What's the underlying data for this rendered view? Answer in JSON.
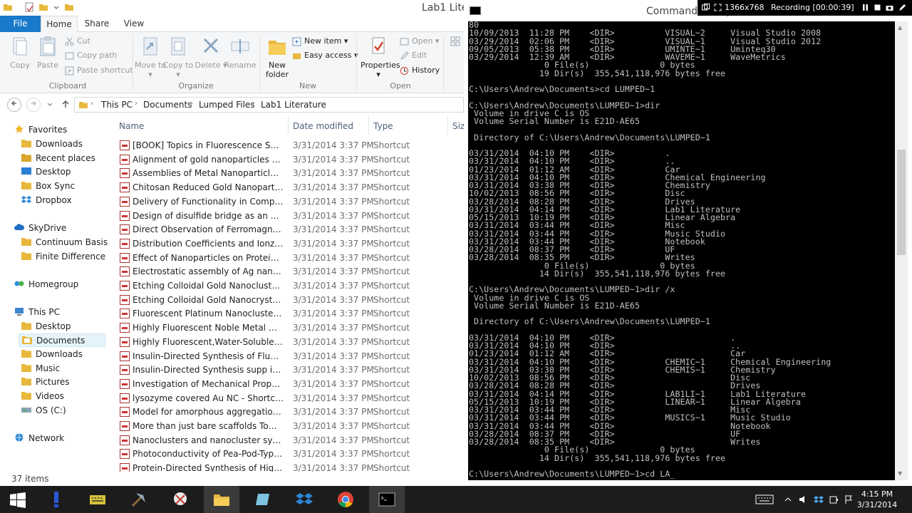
{
  "explorer": {
    "title": "Lab1 Lite",
    "tabs": {
      "file": "File",
      "home": "Home",
      "share": "Share",
      "view": "View"
    },
    "ribbon": {
      "copy": "Copy",
      "paste": "Paste",
      "cut": "Cut",
      "copy_path": "Copy path",
      "paste_shortcut": "Paste shortcut",
      "move_to": "Move to ▾",
      "copy_to": "Copy to ▾",
      "delete": "Delete ▾",
      "rename": "Rename",
      "new_folder": "New folder",
      "new_item": "New item ▾",
      "easy_access": "Easy access ▾",
      "properties": "Properties ▾",
      "open": "Open ▾",
      "edit": "Edit",
      "history": "History",
      "groups": {
        "clipboard": "Clipboard",
        "organize": "Organize",
        "new": "New",
        "open": "Open"
      }
    },
    "breadcrumb": [
      "This PC",
      "Documents",
      "Lumped Files",
      "Lab1 Literature"
    ],
    "nav": {
      "favorites": "Favorites",
      "downloads": "Downloads",
      "recent_places": "Recent places",
      "desktop": "Desktop",
      "box_sync": "Box Sync",
      "dropbox": "Dropbox",
      "skydrive": "SkyDrive",
      "continuum_basis": "Continuum Basis",
      "finite_difference": "Finite Difference Ap",
      "homegroup": "Homegroup",
      "this_pc": "This PC",
      "pc_desktop": "Desktop",
      "pc_documents": "Documents",
      "pc_downloads": "Downloads",
      "pc_music": "Music",
      "pc_pictures": "Pictures",
      "pc_videos": "Videos",
      "pc_os": "OS (C:)",
      "network": "Network"
    },
    "columns": {
      "name": "Name",
      "date": "Date modified",
      "type": "Type",
      "size": "Siz"
    },
    "files": [
      {
        "name": "[BOOK] Topics in Fluorescence Spectrosc...",
        "date": "3/31/2014 3:37 PM",
        "type": "Shortcut"
      },
      {
        "name": "Alignment of gold nanoparticles using in...",
        "date": "3/31/2014 3:37 PM",
        "type": "Shortcut"
      },
      {
        "name": "Assemblies of Metal Nanoparticles and S...",
        "date": "3/31/2014 3:37 PM",
        "type": "Shortcut"
      },
      {
        "name": "Chitosan Reduced Gold Nanoparticles as ...",
        "date": "3/31/2014 3:37 PM",
        "type": "Shortcut"
      },
      {
        "name": "Delivery of Functionality in Complex Foo...",
        "date": "3/31/2014 3:37 PM",
        "type": "Shortcut"
      },
      {
        "name": "Design of disulfide bridge as an alternativ...",
        "date": "3/31/2014 3:37 PM",
        "type": "Shortcut"
      },
      {
        "name": "Direct Observation of Ferromagnetic Spi...",
        "date": "3/31/2014 3:37 PM",
        "type": "Shortcut"
      },
      {
        "name": "Distribution Coefficients and Ionzation C...",
        "date": "3/31/2014 3:37 PM",
        "type": "Shortcut"
      },
      {
        "name": "Effect of Nanoparticles on Protein Foldin...",
        "date": "3/31/2014 3:37 PM",
        "type": "Shortcut"
      },
      {
        "name": "Electrostatic assembly of Ag nanoparticle...",
        "date": "3/31/2014 3:37 PM",
        "type": "Shortcut"
      },
      {
        "name": "Etching Colloidal Gold Nanoclusters sup...",
        "date": "3/31/2014 3:37 PM",
        "type": "Shortcut"
      },
      {
        "name": "Etching Colloidal Gold Nanocrystals with...",
        "date": "3/31/2014 3:37 PM",
        "type": "Shortcut"
      },
      {
        "name": "Fluorescent Platinum Nanoclusters Synth...",
        "date": "3/31/2014 3:37 PM",
        "type": "Shortcut"
      },
      {
        "name": "Highly Fluorescent Noble Metal Quantu...",
        "date": "3/31/2014 3:37 PM",
        "type": "Shortcut"
      },
      {
        "name": "Highly Fluorescent,Water-Soluble, Size-T...",
        "date": "3/31/2014 3:37 PM",
        "type": "Shortcut"
      },
      {
        "name": "Insulin-Directed Synthesis of Fluorescent ...",
        "date": "3/31/2014 3:37 PM",
        "type": "Shortcut"
      },
      {
        "name": "Insulin-Directed Synthesis supp info - Sh...",
        "date": "3/31/2014 3:37 PM",
        "type": "Shortcut"
      },
      {
        "name": "Investigation of Mechanical Properties of...",
        "date": "3/31/2014 3:37 PM",
        "type": "Shortcut"
      },
      {
        "name": "lysozyme covered Au NC - Shortcut",
        "date": "3/31/2014 3:37 PM",
        "type": "Shortcut"
      },
      {
        "name": "Model for amorphous aggregation proce...",
        "date": "3/31/2014 3:37 PM",
        "type": "Shortcut"
      },
      {
        "name": "More than just bare scaffolds Towards m...",
        "date": "3/31/2014 3:37 PM",
        "type": "Shortcut"
      },
      {
        "name": "Nanoclusters and nanocluster systems. A...",
        "date": "3/31/2014 3:37 PM",
        "type": "Shortcut"
      },
      {
        "name": "Photoconductivity of Pea-Pod-Type Cha...",
        "date": "3/31/2014 3:37 PM",
        "type": "Shortcut"
      },
      {
        "name": "Protein-Directed Synthesis of Highly Fluo...",
        "date": "3/31/2014 3:37 PM",
        "type": "Shortcut"
      }
    ],
    "status": "37 items"
  },
  "cmd": {
    "title": "Command Prompt",
    "recorder_size": "1366x768",
    "recorder_label": "Recording [00:00:39]",
    "lines": [
      "80",
      "10/09/2013  11:28 PM    <DIR>          VISUAL~2     Visual Studio 2008",
      "03/29/2014  02:06 PM    <DIR>          VISUAL~1     Visual Studio 2012",
      "09/05/2013  05:38 PM    <DIR>          UMINTE~1     Uminteq30",
      "03/29/2014  12:39 AM    <DIR>          WAVEME~1     WaveMetrics",
      "               0 File(s)              0 bytes",
      "              19 Dir(s)  355,541,118,976 bytes free",
      "",
      "C:\\Users\\Andrew\\Documents>cd LUMPED~1",
      "",
      "C:\\Users\\Andrew\\Documents\\LUMPED~1>dir",
      " Volume in drive C is OS",
      " Volume Serial Number is E21D-AE65",
      "",
      " Directory of C:\\Users\\Andrew\\Documents\\LUMPED~1",
      "",
      "03/31/2014  04:10 PM    <DIR>          .",
      "03/31/2014  04:10 PM    <DIR>          ..",
      "01/23/2014  01:12 AM    <DIR>          Car",
      "03/31/2014  04:10 PM    <DIR>          Chemical Engineering",
      "03/31/2014  03:38 PM    <DIR>          Chemistry",
      "10/02/2013  08:56 PM    <DIR>          Disc",
      "03/28/2014  08:28 PM    <DIR>          Drives",
      "03/31/2014  04:14 PM    <DIR>          Lab1 Literature",
      "05/15/2013  10:19 PM    <DIR>          Linear Algebra",
      "03/31/2014  03:44 PM    <DIR>          Misc",
      "03/31/2014  03:44 PM    <DIR>          Music Studio",
      "03/31/2014  03:44 PM    <DIR>          Notebook",
      "03/28/2014  08:37 PM    <DIR>          UF",
      "03/28/2014  08:35 PM    <DIR>          Writes",
      "               0 File(s)              0 bytes",
      "              14 Dir(s)  355,541,118,976 bytes free",
      "",
      "C:\\Users\\Andrew\\Documents\\LUMPED~1>dir /x",
      " Volume in drive C is OS",
      " Volume Serial Number is E21D-AE65",
      "",
      " Directory of C:\\Users\\Andrew\\Documents\\LUMPED~1",
      "",
      "03/31/2014  04:10 PM    <DIR>                       .",
      "03/31/2014  04:10 PM    <DIR>                       ..",
      "01/23/2014  01:12 AM    <DIR>                       Car",
      "03/31/2014  04:10 PM    <DIR>          CHEMIC~1     Chemical Engineering",
      "03/31/2014  03:38 PM    <DIR>          CHEMIS~1     Chemistry",
      "10/02/2013  08:56 PM    <DIR>                       Disc",
      "03/28/2014  08:28 PM    <DIR>                       Drives",
      "03/31/2014  04:14 PM    <DIR>          LAB1LI~1     Lab1 Literature",
      "05/15/2013  10:19 PM    <DIR>          LINEAR~1     Linear Algebra",
      "03/31/2014  03:44 PM    <DIR>                       Misc",
      "03/31/2014  03:44 PM    <DIR>          MUSICS~1     Music Studio",
      "03/31/2014  03:44 PM    <DIR>                       Notebook",
      "03/28/2014  08:37 PM    <DIR>                       UF",
      "03/28/2014  08:35 PM    <DIR>                       Writes",
      "               0 File(s)              0 bytes",
      "              14 Dir(s)  355,541,118,976 bytes free",
      "",
      "C:\\Users\\Andrew\\Documents\\LUMPED~1>cd LA_"
    ]
  },
  "taskbar": {
    "time": "4:15 PM",
    "date": "3/31/2014"
  }
}
